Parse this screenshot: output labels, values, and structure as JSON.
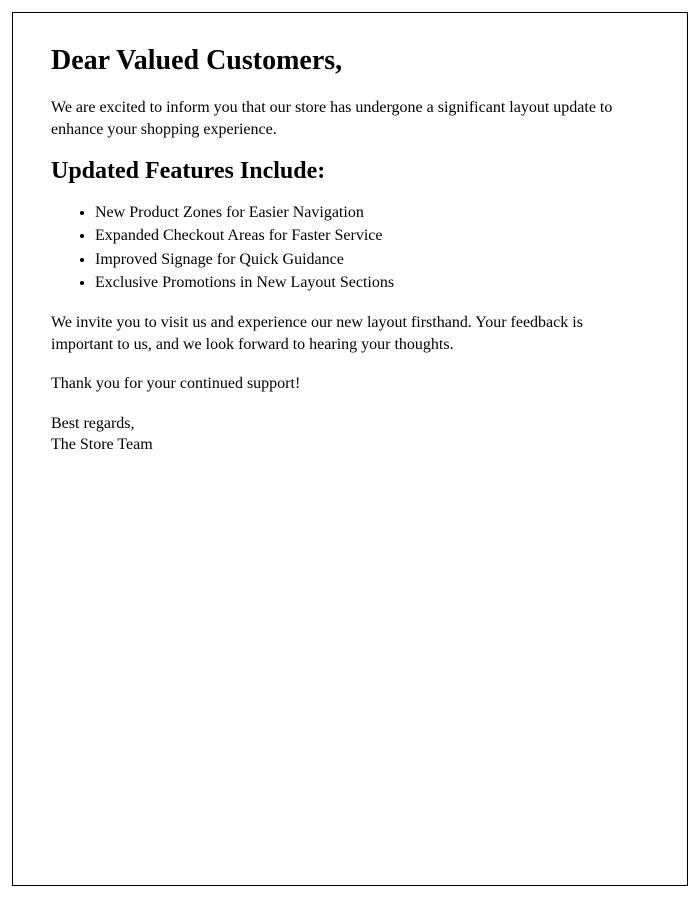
{
  "letter": {
    "greeting": "Dear Valued Customers,",
    "intro": "We are excited to inform you that our store has undergone a significant layout update to enhance your shopping experience.",
    "features_heading": "Updated Features Include:",
    "features": [
      "New Product Zones for Easier Navigation",
      "Expanded Checkout Areas for Faster Service",
      "Improved Signage for Quick Guidance",
      "Exclusive Promotions in New Layout Sections"
    ],
    "invite": "We invite you to visit us and experience our new layout firsthand. Your feedback is important to us, and we look forward to hearing your thoughts.",
    "thanks": "Thank you for your continued support!",
    "closing": "Best regards,",
    "signature": "The Store Team"
  }
}
